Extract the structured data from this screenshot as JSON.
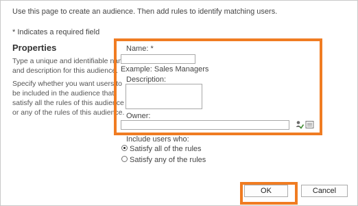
{
  "intro_text": "Use this page to create an audience. Then add rules to identify matching users.",
  "required_note": "* Indicates a required field",
  "properties": {
    "title": "Properties",
    "help_lines_1": [
      "Type a unique and identifiable name",
      "and description for this audience."
    ],
    "help_lines_2": [
      "Specify whether you want users to",
      "be included in the audience that",
      "satisfy all the rules of this audience",
      "or any of the rules of this audience."
    ]
  },
  "form": {
    "name_label": "Name: *",
    "name_value": "",
    "example_text": "Example: Sales Managers",
    "description_label": "Description:",
    "description_value": "",
    "owner_label": "Owner:",
    "owner_value": "",
    "check_names_icon": "check-names-icon",
    "browse_icon": "address-book-icon"
  },
  "include": {
    "label": "Include users who:",
    "options": [
      "Satisfy all of the rules",
      "Satisfy any of the rules"
    ],
    "selected": "Satisfy all of the rules"
  },
  "buttons": {
    "ok": "OK",
    "cancel": "Cancel"
  },
  "colors": {
    "highlight": "#f07c22"
  }
}
